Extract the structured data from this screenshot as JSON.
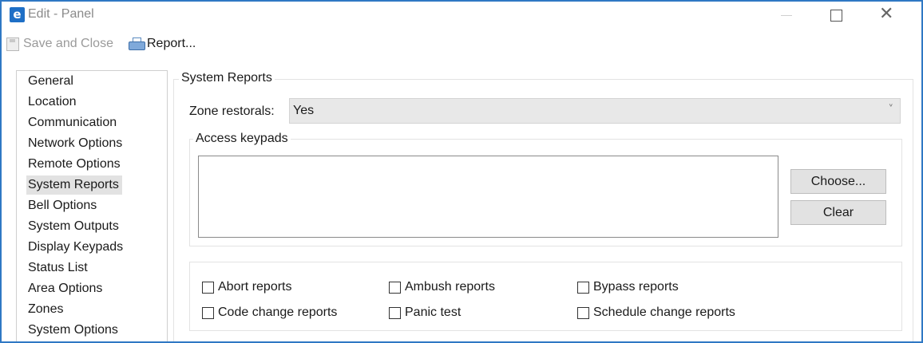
{
  "window": {
    "title": "Edit - Panel",
    "app_icon_glyph": "e",
    "controls": {
      "minimize": "minimize-icon",
      "maximize": "maximize-icon",
      "close": "close-icon",
      "close_glyph": "✕"
    }
  },
  "toolbar": {
    "save_close_label": "Save and Close",
    "report_label": "Report...",
    "save_icon": "save-icon",
    "report_icon": "printer-icon"
  },
  "sidebar": {
    "items": [
      {
        "label": "General"
      },
      {
        "label": "Location"
      },
      {
        "label": "Communication"
      },
      {
        "label": "Network Options"
      },
      {
        "label": "Remote Options"
      },
      {
        "label": "System Reports",
        "selected": true
      },
      {
        "label": "Bell Options"
      },
      {
        "label": "System Outputs"
      },
      {
        "label": "Display Keypads"
      },
      {
        "label": "Status List"
      },
      {
        "label": "Area Options"
      },
      {
        "label": "Zones"
      },
      {
        "label": "System Options"
      }
    ]
  },
  "main": {
    "group_title": "System Reports",
    "zone_restorals": {
      "label": "Zone restorals:",
      "value": "Yes",
      "chevron": "˅"
    },
    "access_keypads": {
      "title": "Access keypads",
      "choose_label": "Choose...",
      "clear_label": "Clear"
    },
    "checkboxes": {
      "abort": "Abort reports",
      "ambush": "Ambush reports",
      "bypass": "Bypass reports",
      "code_change": "Code change reports",
      "panic_test": "Panic test",
      "schedule_change": "Schedule change reports"
    }
  },
  "colors": {
    "window_border": "#2f78c4",
    "selected_bg": "#e2e2e2",
    "button_bg": "#e2e2e2",
    "select_bg": "#e8e8e8"
  }
}
